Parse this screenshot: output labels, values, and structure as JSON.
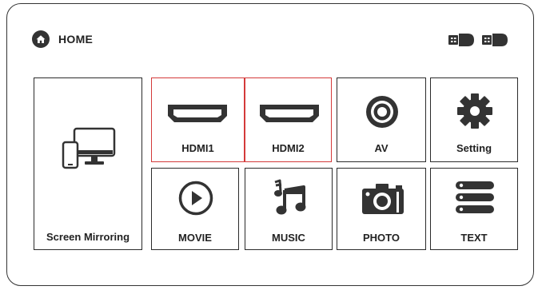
{
  "header": {
    "title": "HOME",
    "icon": "home-icon"
  },
  "status": {
    "icons": [
      "usb-drive-icon",
      "usb-drive-icon"
    ]
  },
  "tiles": {
    "screen_mirroring": "Screen Mirroring",
    "hdmi1": "HDMI1",
    "hdmi2": "HDMI2",
    "av": "AV",
    "setting": "Setting",
    "movie": "MOVIE",
    "music": "MUSIC",
    "photo": "PHOTO",
    "text": "TEXT"
  },
  "colors": {
    "selected_border": "#d43a3a",
    "icon": "#333333"
  }
}
